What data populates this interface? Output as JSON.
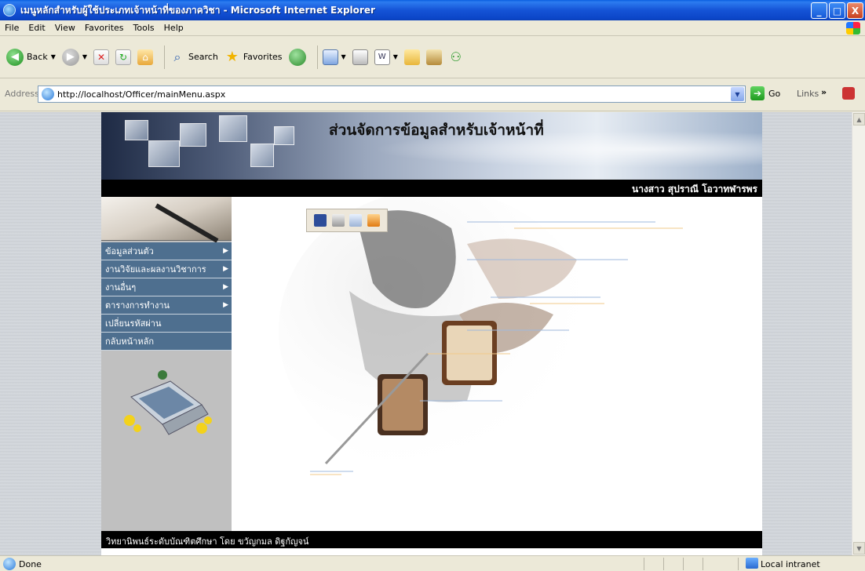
{
  "window": {
    "title": "เมนูหลักสำหรับผู้ใช้ประเภทเจ้าหน้าที่ของภาควิชา - Microsoft Internet Explorer",
    "minimize": "_",
    "maximize": "□",
    "close": "X"
  },
  "menubar": {
    "items": [
      "File",
      "Edit",
      "View",
      "Favorites",
      "Tools",
      "Help"
    ]
  },
  "toolbar": {
    "back": "Back",
    "search": "Search",
    "favorites": "Favorites"
  },
  "address": {
    "label": "Address",
    "url": "http://localhost/Officer/mainMenu.aspx",
    "go": "Go",
    "links": "Links",
    "links_arrow": "»"
  },
  "page": {
    "banner_title": "ส่วนจัดการข้อมูลสำหรับเจ้าหน้าที่",
    "user_name": "นางสาว สุปราณี โอวาทฬารพร",
    "menu": [
      {
        "label": "ข้อมูลส่วนตัว",
        "has_submenu": true
      },
      {
        "label": "งานวิจัยและผลงานวิชาการ",
        "has_submenu": true
      },
      {
        "label": "งานอื่นๆ",
        "has_submenu": true
      },
      {
        "label": "ตารางการทำงาน",
        "has_submenu": true
      },
      {
        "label": "เปลี่ยนรหัสผ่าน",
        "has_submenu": false
      },
      {
        "label": "กลับหน้าหลัก",
        "has_submenu": false
      }
    ],
    "footer": "วิทยานิพนธ์ระดับบัณฑิตศึกษา โดย ขวัญกมล ดิฐกัญจน์"
  },
  "status": {
    "text": "Done",
    "zone": "Local intranet"
  },
  "colors": {
    "menu_item": "#4e6f8f",
    "sidebar": "#c0c0c0",
    "titlebar": "#0b46c8"
  }
}
